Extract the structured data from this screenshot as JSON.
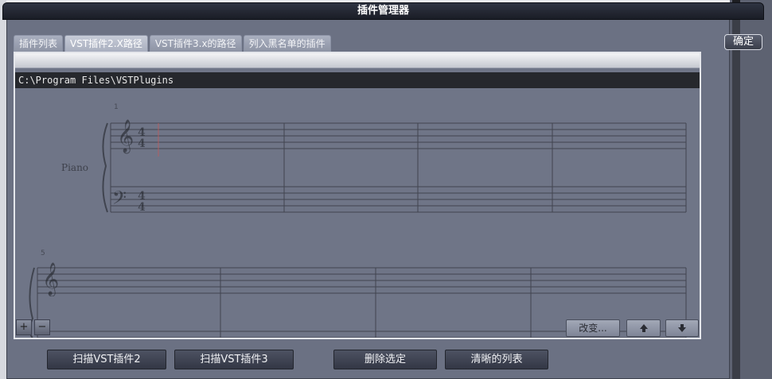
{
  "dialog": {
    "title": "插件管理器",
    "ok_label": "确定"
  },
  "tabs": [
    {
      "label": "插件列表",
      "active": false
    },
    {
      "label": "VST插件2.X路径",
      "active": true
    },
    {
      "label": "VST插件3.x的路径",
      "active": false
    },
    {
      "label": "列入黑名单的插件",
      "active": false
    }
  ],
  "path_list": [
    "C:\\Program Files\\VSTPlugins"
  ],
  "score_background": {
    "instrument": "Piano",
    "measure_numbers": [
      "1",
      "5"
    ]
  },
  "panel_buttons": {
    "add": "+",
    "remove": "−",
    "change": "改变...",
    "move_up_icon": "arrow-up-icon",
    "move_down_icon": "arrow-down-icon"
  },
  "bottom_buttons": {
    "scan_vst2": "扫描VST插件2",
    "scan_vst3": "扫描VST插件3",
    "delete_selected": "删除选定",
    "clear_list": "清晰的列表"
  }
}
